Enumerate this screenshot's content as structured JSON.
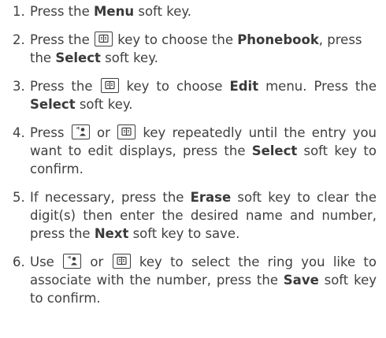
{
  "steps": [
    {
      "num": "1.",
      "parts": [
        {
          "t": "text",
          "v": "Press the "
        },
        {
          "t": "bold",
          "v": "Menu"
        },
        {
          "t": "text",
          "v": " soft key."
        }
      ]
    },
    {
      "num": "2.",
      "parts": [
        {
          "t": "text",
          "v": "Press the "
        },
        {
          "t": "key",
          "icon": "phonebook-key-icon"
        },
        {
          "t": "text",
          "v": " key to choose the "
        },
        {
          "t": "bold",
          "v": "Phonebook"
        },
        {
          "t": "text",
          "v": ", press the "
        },
        {
          "t": "bold",
          "v": "Select"
        },
        {
          "t": "text",
          "v": " soft key."
        }
      ]
    },
    {
      "num": "3.",
      "parts": [
        {
          "t": "text",
          "v": "Press the "
        },
        {
          "t": "key",
          "icon": "phonebook-key-icon"
        },
        {
          "t": "text",
          "v": " key to choose "
        },
        {
          "t": "bold",
          "v": "Edit"
        },
        {
          "t": "text",
          "v": " menu. Press the "
        },
        {
          "t": "bold",
          "v": "Select"
        },
        {
          "t": "text",
          "v": " soft key."
        }
      ]
    },
    {
      "num": "4.",
      "parts": [
        {
          "t": "text",
          "v": "Press "
        },
        {
          "t": "key",
          "icon": "up-key-icon"
        },
        {
          "t": "text",
          "v": " or "
        },
        {
          "t": "key",
          "icon": "phonebook-key-icon"
        },
        {
          "t": "text",
          "v": " key repeatedly until the entry you want to edit displays, press the "
        },
        {
          "t": "bold",
          "v": "Select"
        },
        {
          "t": "text",
          "v": " soft key to confirm."
        }
      ]
    },
    {
      "num": "5.",
      "parts": [
        {
          "t": "text",
          "v": "If necessary, press the "
        },
        {
          "t": "bold",
          "v": "Erase"
        },
        {
          "t": "text",
          "v": " soft key to clear the digit(s) then enter the desired name and number, press the "
        },
        {
          "t": "bold",
          "v": "Next"
        },
        {
          "t": "text",
          "v": " soft key to save."
        }
      ]
    },
    {
      "num": "6.",
      "parts": [
        {
          "t": "text",
          "v": "Use "
        },
        {
          "t": "key",
          "icon": "up-key-icon"
        },
        {
          "t": "text",
          "v": " or "
        },
        {
          "t": "key",
          "icon": "phonebook-key-icon"
        },
        {
          "t": "text",
          "v": " key to select the ring you like to associate with the number, press the "
        },
        {
          "t": "bold",
          "v": "Save"
        },
        {
          "t": "text",
          "v": " soft key to confirm."
        }
      ]
    }
  ]
}
